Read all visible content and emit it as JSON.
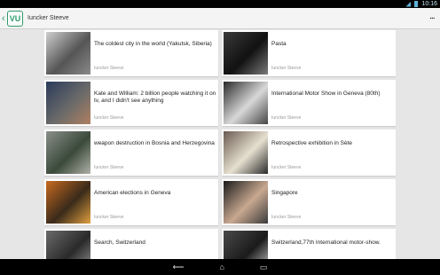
{
  "status": {
    "time": "10:16"
  },
  "header": {
    "logo": "VU",
    "title": "Iuncker Steeve",
    "overflow": "▪▪▪"
  },
  "cards": [
    {
      "title": "The coldest city in the world (Yakutsk, Siberia)",
      "author": "Iuncker Steeve",
      "thumb_colors": [
        "#cfcfcf",
        "#555555",
        "#8a8a8a"
      ]
    },
    {
      "title": "Pasta",
      "author": "Iuncker Steeve",
      "thumb_colors": [
        "#3a3a3a",
        "#111111",
        "#7a7a7a"
      ]
    },
    {
      "title": "Kate and William: 2 billion people watching it on tv, and I didn't see anything",
      "author": "Iuncker Steeve",
      "thumb_colors": [
        "#2b3b5a",
        "#6a6a6a",
        "#b08060"
      ]
    },
    {
      "title": "International Motor Show in Geneva (80th)",
      "author": "Iuncker Steeve",
      "thumb_colors": [
        "#2a2a2a",
        "#d8d8d8",
        "#444444"
      ]
    },
    {
      "title": "weapon destruction in Bosnia and Herzegovina",
      "author": "Iuncker Steeve",
      "thumb_colors": [
        "#8a8f8a",
        "#3a4a3a",
        "#b0b0a8"
      ]
    },
    {
      "title": "Retrospective exhibition in Sète",
      "author": "Iuncker Steeve",
      "thumb_colors": [
        "#6a5a50",
        "#e6e0d0",
        "#2a2a2a"
      ]
    },
    {
      "title": "American elections in Geneva",
      "author": "Iuncker Steeve",
      "thumb_colors": [
        "#c86a20",
        "#3a2a1a",
        "#e0a040"
      ]
    },
    {
      "title": "Singapore",
      "author": "Iuncker Steeve",
      "thumb_colors": [
        "#1a1a1a",
        "#c8a890",
        "#3a3a3a"
      ]
    },
    {
      "title": "Search, Switzerland",
      "author": "Iuncker Steeve",
      "thumb_colors": [
        "#6a6a6a",
        "#2a2a2a",
        "#9a9a9a"
      ]
    },
    {
      "title": "Switzerland,77th International motor-show.",
      "author": "Iuncker Steeve",
      "thumb_colors": [
        "#4a4a4a",
        "#1a1a1a",
        "#d0d0d0"
      ]
    }
  ],
  "nav": {
    "back": "⟵",
    "home": "⌂",
    "recents": "▭"
  }
}
